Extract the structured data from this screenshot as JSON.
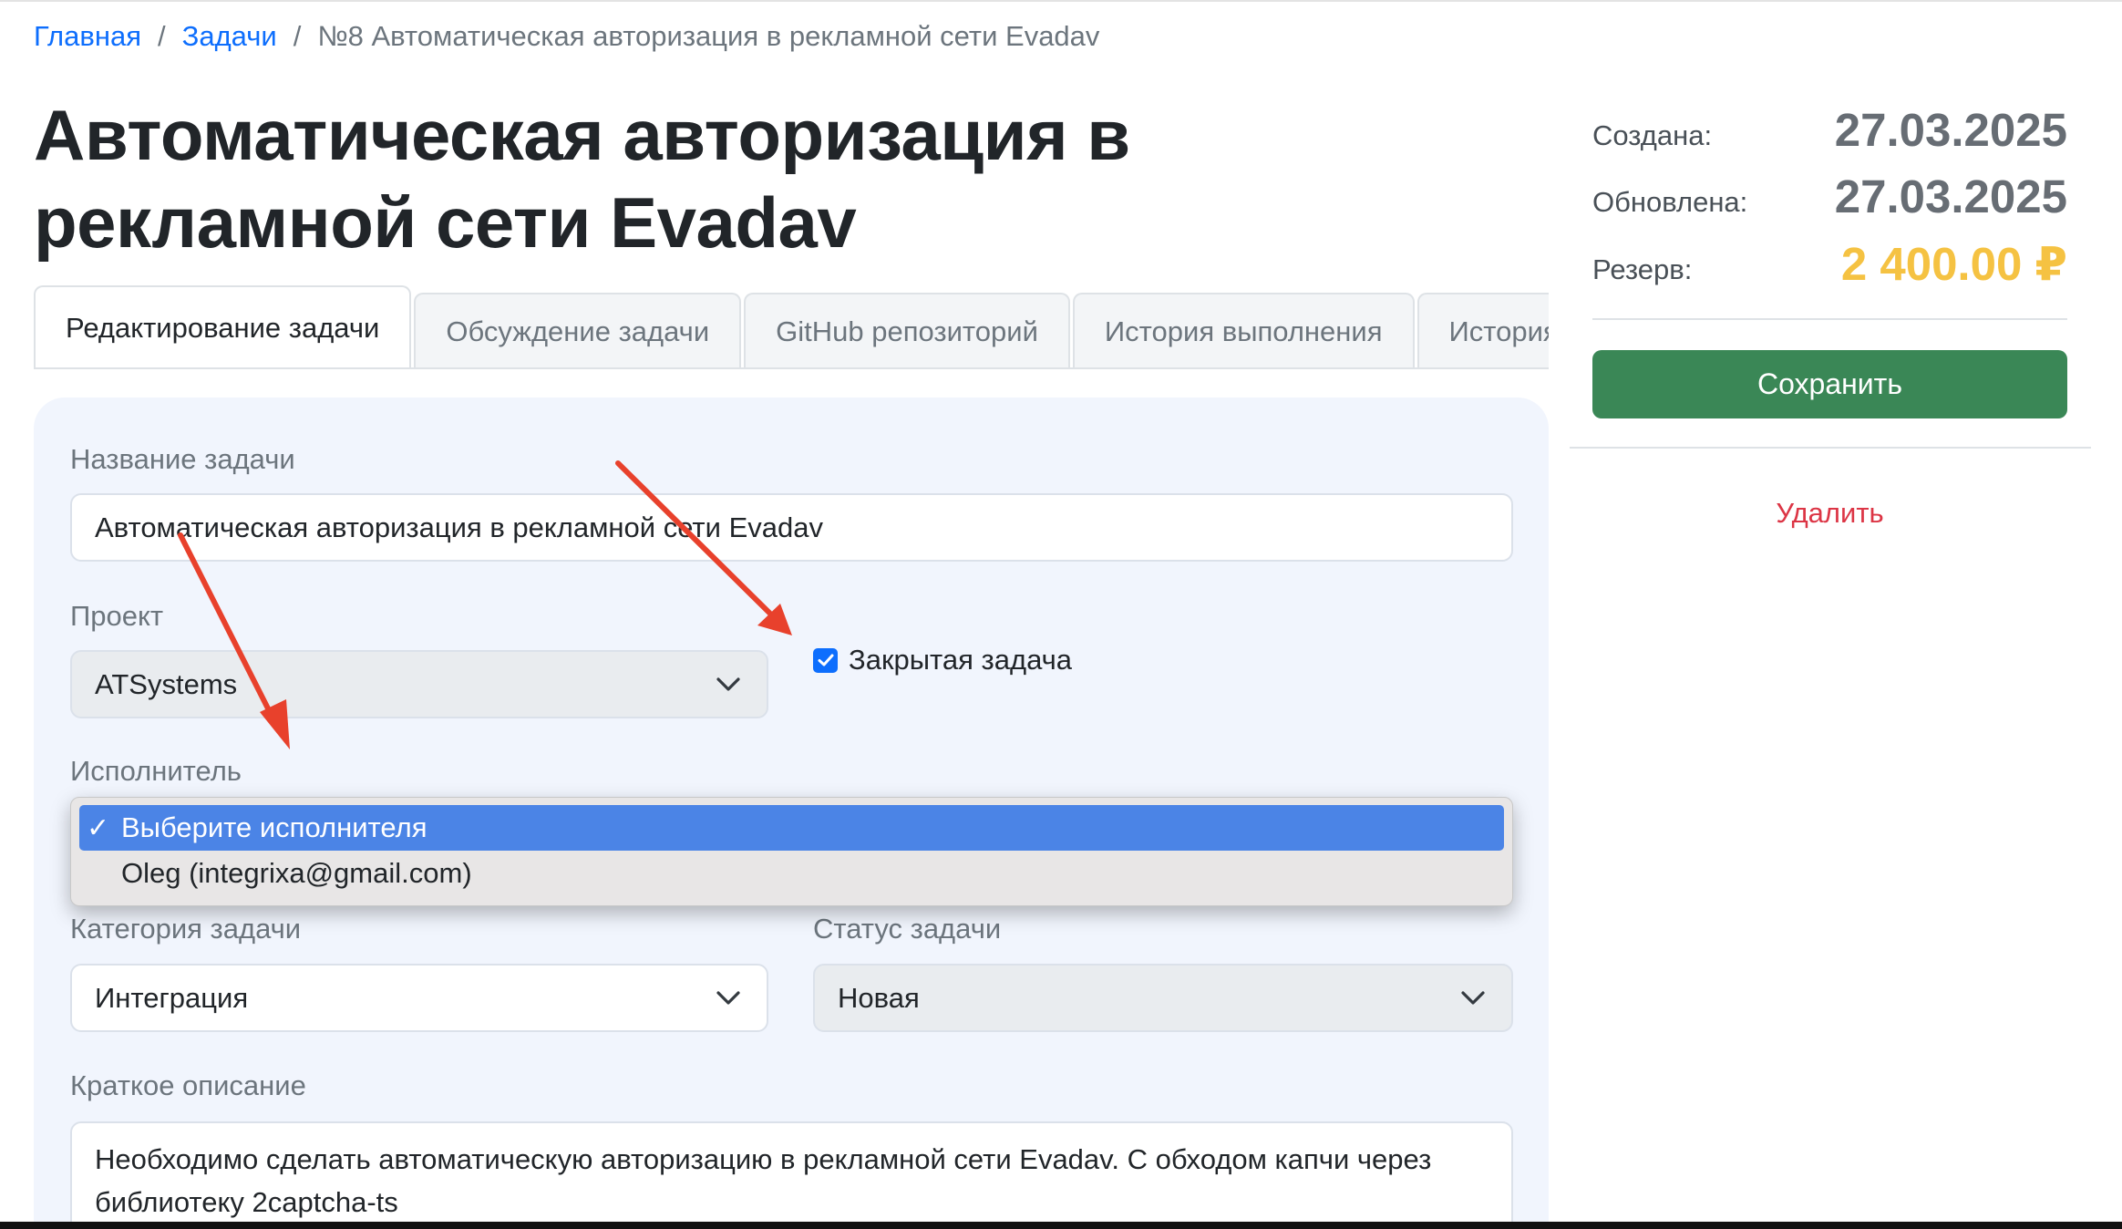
{
  "breadcrumb": {
    "home": "Главная",
    "tasks": "Задачи",
    "separator": "/",
    "current": "№8 Автоматическая авторизация в рекламной сети Evadav"
  },
  "page_title": "Автоматическая авторизация в рекламной сети Evadav",
  "tabs": [
    {
      "label": "Редактирование задачи",
      "active": true
    },
    {
      "label": "Обсуждение задачи",
      "active": false
    },
    {
      "label": "GitHub репозиторий",
      "active": false
    },
    {
      "label": "История выполнения",
      "active": false
    },
    {
      "label": "История",
      "active": false
    }
  ],
  "form": {
    "name_label": "Название задачи",
    "name_value": "Автоматическая авторизация в рекламной сети Evadav",
    "project_label": "Проект",
    "project_value": "ATSystems",
    "closed_label": "Закрытая задача",
    "closed_checked": true,
    "executor_label": "Исполнитель",
    "executor_options": [
      {
        "label": "Выберите исполнителя",
        "selected": true
      },
      {
        "label": "Oleg (integrixa@gmail.com)",
        "selected": false
      }
    ],
    "category_label": "Категория задачи",
    "category_value": "Интеграция",
    "status_label": "Статус задачи",
    "status_value": "Новая",
    "description_label": "Краткое описание",
    "description_value": "Необходимо сделать автоматическую авторизацию в рекламной сети Evadav. С обходом капчи через библиотеку 2captcha-ts"
  },
  "sidebar": {
    "created_label": "Создана:",
    "created_value": "27.03.2025",
    "updated_label": "Обновлена:",
    "updated_value": "27.03.2025",
    "reserve_label": "Резерв:",
    "reserve_value": "2 400.00 ₽",
    "save_label": "Сохранить",
    "delete_label": "Удалить"
  },
  "colors": {
    "link": "#0d6efd",
    "save_button": "#3a8756",
    "delete": "#dc3545",
    "reserve": "#f5c242",
    "annotation_arrow": "#e8412c",
    "selected_option": "#4b84e6"
  },
  "icons": {
    "select_caret": "chevron-down-icon",
    "checkbox": "checkmark-icon",
    "option_tick": "checkmark-icon",
    "annotation": "red-arrow-icon"
  }
}
